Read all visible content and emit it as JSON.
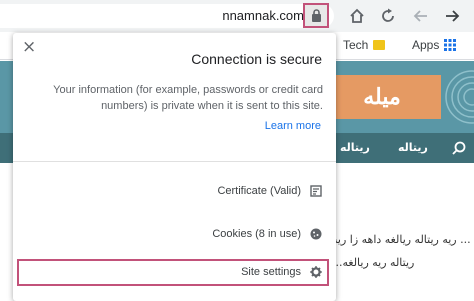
{
  "toolbar": {
    "url": "nnamnak.com",
    "back_icon": "arrow-right-icon",
    "forward_icon": "arrow-left-icon",
    "reload_icon": "reload-icon",
    "home_icon": "home-icon",
    "lock_icon": "lock-icon"
  },
  "bookmarks": {
    "apps_label": "Apps",
    "tech_label": "Tech"
  },
  "site": {
    "logo_text": "میله",
    "nav_items": [
      "ریتاله",
      "ریتاله"
    ],
    "content_lines": [
      "ریه ریتاله ریالغه داهه زا ریه ...",
      "...ریتاله ریه ریالغه"
    ]
  },
  "popup": {
    "close_label": "×",
    "title": "Connection is secure",
    "description": "Your information (for example, passwords or credit card numbers) is private when it is sent to this site.",
    "learn_more": "Learn more",
    "certificate_label": "Certificate (Valid)",
    "cookies_label": "Cookies (8 in use)",
    "site_settings_label": "Site settings"
  },
  "colors": {
    "highlight": "#c2527a",
    "banner": "#5a97a6",
    "site_nav": "#3f6f78",
    "logo_bg": "#e59a63",
    "link": "#1a73e8"
  }
}
